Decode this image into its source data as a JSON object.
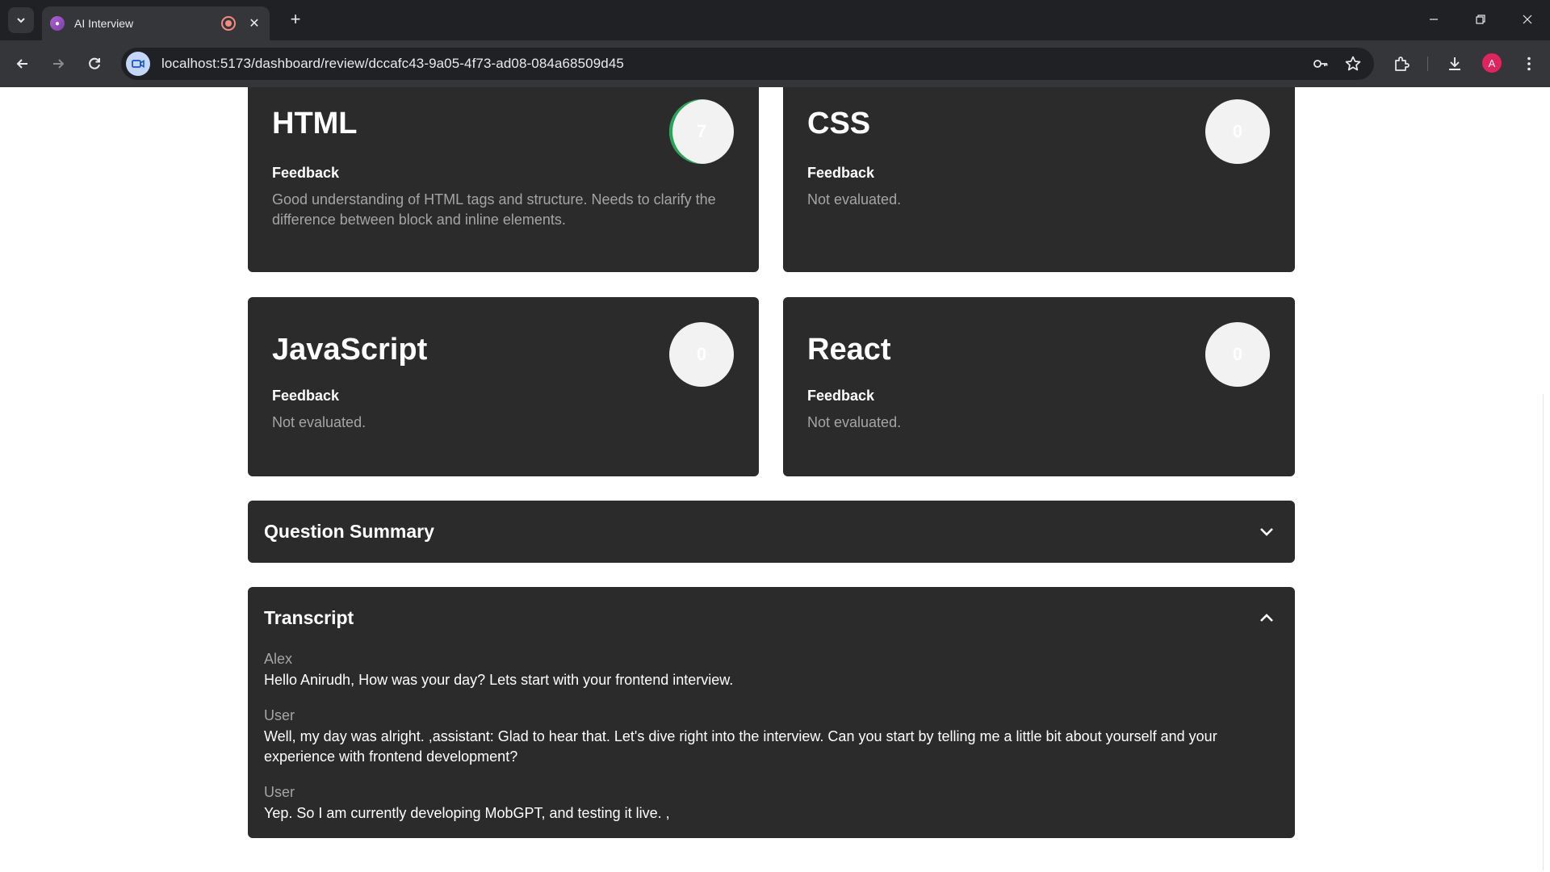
{
  "browser": {
    "tab_title": "AI Interview",
    "url": "localhost:5173/dashboard/review/dccafc43-9a05-4f73-ad08-084a68509d45",
    "profile_initial": "A",
    "new_tab_glyph": "+",
    "close_glyph": "✕"
  },
  "skills": [
    {
      "name": "HTML",
      "score": "7",
      "feedback_label": "Feedback",
      "feedback": "Good understanding of HTML tags and structure. Needs to clarify the difference between block and inline elements."
    },
    {
      "name": "CSS",
      "score": "0",
      "feedback_label": "Feedback",
      "feedback": "Not evaluated."
    },
    {
      "name": "JavaScript",
      "score": "0",
      "feedback_label": "Feedback",
      "feedback": "Not evaluated."
    },
    {
      "name": "React",
      "score": "0",
      "feedback_label": "Feedback",
      "feedback": "Not evaluated."
    }
  ],
  "question_summary": {
    "title": "Question Summary",
    "expanded": false
  },
  "transcript": {
    "title": "Transcript",
    "expanded": true,
    "messages": [
      {
        "role": "Alex",
        "text": "Hello Anirudh, How was your day? Lets start with your frontend interview."
      },
      {
        "role": "User",
        "text": "Well, my day was alright. ,assistant: Glad to hear that. Let's dive right into the interview. Can you start by telling me a little bit about yourself and your experience with frontend development?"
      },
      {
        "role": "User",
        "text": "Yep. So I am currently developing MobGPT, and testing it live. ,"
      }
    ]
  },
  "colors": {
    "card_bg": "#2b2b2b",
    "score_ring": "#22a559",
    "page_bg": "#ffffff"
  }
}
